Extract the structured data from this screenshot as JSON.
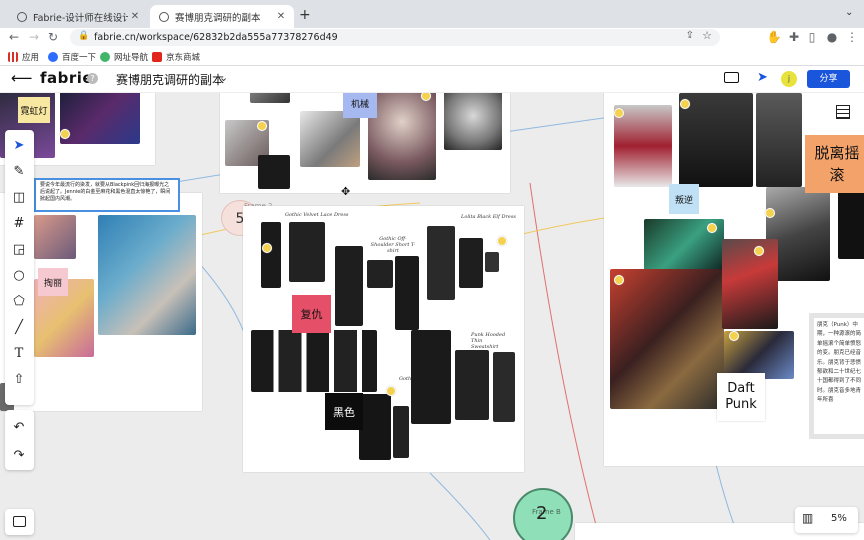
{
  "browser": {
    "tabs": [
      {
        "title": "Fabrie-设计师在线设计协作平台",
        "active": false
      },
      {
        "title": "赛博朋克调研的副本",
        "active": true
      }
    ],
    "url": "fabrie.cn/workspace/62832b2da555a77378276d49",
    "bookmarks": [
      "应用",
      "百度一下",
      "网址导航",
      "京东商城"
    ],
    "icons": [
      "back-icon",
      "forward-icon",
      "reload-icon",
      "lock-icon",
      "share-icon",
      "star-icon",
      "extension-icon",
      "puzzle-icon",
      "sidebar-icon",
      "profile-icon",
      "menu-icon"
    ]
  },
  "app": {
    "logo": "fabrie",
    "doc_title": "赛博朋克调研的副本",
    "share_label": "分享",
    "avatar_letter": "j",
    "colors": {
      "accent": "#1a56db",
      "avatar": "#e8e23c"
    }
  },
  "toolbar": {
    "tools": [
      "select-icon",
      "pen-icon",
      "layout-icon",
      "frame-icon",
      "sticky-note-icon",
      "circle-icon",
      "polygon-icon",
      "line-icon",
      "text-icon",
      "upload-icon",
      "undo-icon",
      "redo-icon"
    ]
  },
  "canvas": {
    "stickies": {
      "neon": "霓虹灯",
      "machine": "机械",
      "eyelash": "掏丽",
      "hatred": "复仇",
      "black": "黑色",
      "rebel": "叛逆",
      "detach": "脱离摇滚",
      "daft": "Daft Punk"
    },
    "note_text": "要说今年最流行的染发，就要从Blackpink回归海报曝光之后说起了。Jennie的白金至麻花和黑色混直太惊艳了，瞬间掀起国内风潮。",
    "frame_label": "Frame 2",
    "frame_b_label": "Frame B",
    "marker_5": "5",
    "marker_2": "2",
    "punk_text": "朋克（Punk）中期，一种源滚的简单摇滚个简单愤怒的变。朋克已经音乐。朋克背于悲愤郁欲和二十世纪七十国都得到了不同时。朋克音多地青年所喜",
    "product_captions": {
      "gothic_lace": "Gothic Velvet Lace Dress",
      "gothic_shoulder": "Gothic Off-Shoulder Short T-shirt",
      "lolita": "Lolita Black Elf Dress",
      "punk_hooded": "Punk Hooded Thin Sweatshirt",
      "gothic_short": "Gothic"
    }
  },
  "footer": {
    "zoom": "5%"
  }
}
